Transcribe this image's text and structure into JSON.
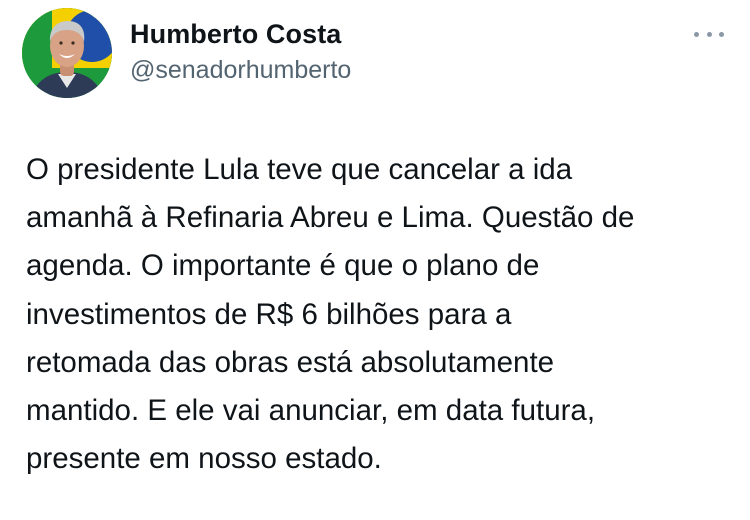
{
  "author": {
    "display_name": "Humberto Costa",
    "handle": "@senadorhumberto"
  },
  "tweet": {
    "text": "O presidente Lula teve que cancelar a ida\namanhã à Refinaria Abreu e Lima. Questão de\nagenda. O importante é que o plano de\ninvestimentos de R$ 6 bilhões para a\nretomada das obras está absolutamente\nmantido. E ele vai anunciar, em data futura,\npresente em nosso estado."
  },
  "icons": {
    "more": "more-horizontal-icon"
  },
  "colors": {
    "text": "#0f1419",
    "secondary": "#536471",
    "avatar_flag_green": "#1d9a3c",
    "avatar_flag_yellow": "#f5d000",
    "avatar_flag_blue": "#1f4fa8"
  }
}
